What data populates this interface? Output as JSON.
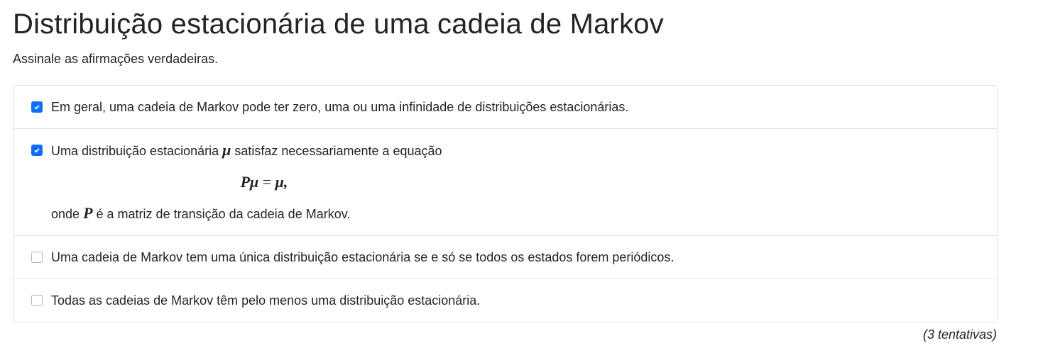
{
  "title": "Distribuição estacionária de uma cadeia de Markov",
  "subtitle": "Assinale as afirmações verdadeiras.",
  "options": [
    {
      "checked": true,
      "text": "Em geral, uma cadeia de Markov pode ter zero, uma ou uma infinidade de distribuições estacionárias."
    },
    {
      "checked": true,
      "text_before": "Uma distribuição estacionária",
      "symbol_mu": "μ",
      "text_after": "satisfaz necessariamente a equação",
      "equation_lhs": "Pμ",
      "equation_eq": "=",
      "equation_rhs": "μ,",
      "line2_before": "onde",
      "symbol_P": "P",
      "line2_after": "é a matriz de transição da cadeia de Markov."
    },
    {
      "checked": false,
      "text": "Uma cadeia de Markov tem uma única distribuição estacionária se e só se todos os estados forem periódicos."
    },
    {
      "checked": false,
      "text": "Todas as cadeias de Markov têm pelo menos uma distribuição estacionária."
    }
  ],
  "attempts": "(3 tentativas)",
  "accent": "#0d6efd"
}
